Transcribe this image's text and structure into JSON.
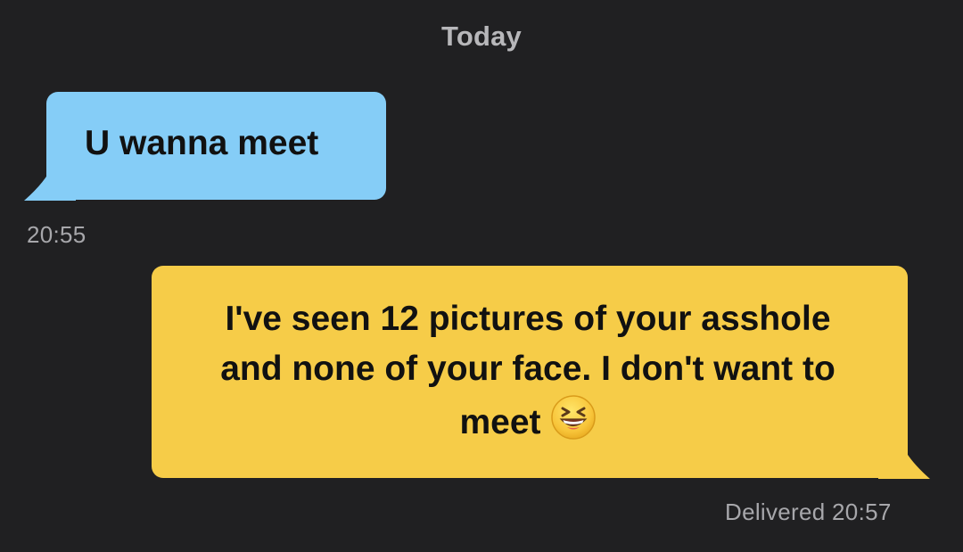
{
  "chat": {
    "day_label": "Today",
    "messages": [
      {
        "direction": "incoming",
        "text": "U wanna meet",
        "time": "20:55"
      },
      {
        "direction": "outgoing",
        "text": "I've seen 12 pictures of your asshole and none of your face. I don't want to meet",
        "emoji": "grinning-squinting-face-emoji",
        "status_time": "Delivered 20:57"
      }
    ],
    "colors": {
      "background": "#202022",
      "incoming_bubble": "#85CDF7",
      "outgoing_bubble": "#F6CC48",
      "timestamp": "#a7a7ab"
    }
  }
}
